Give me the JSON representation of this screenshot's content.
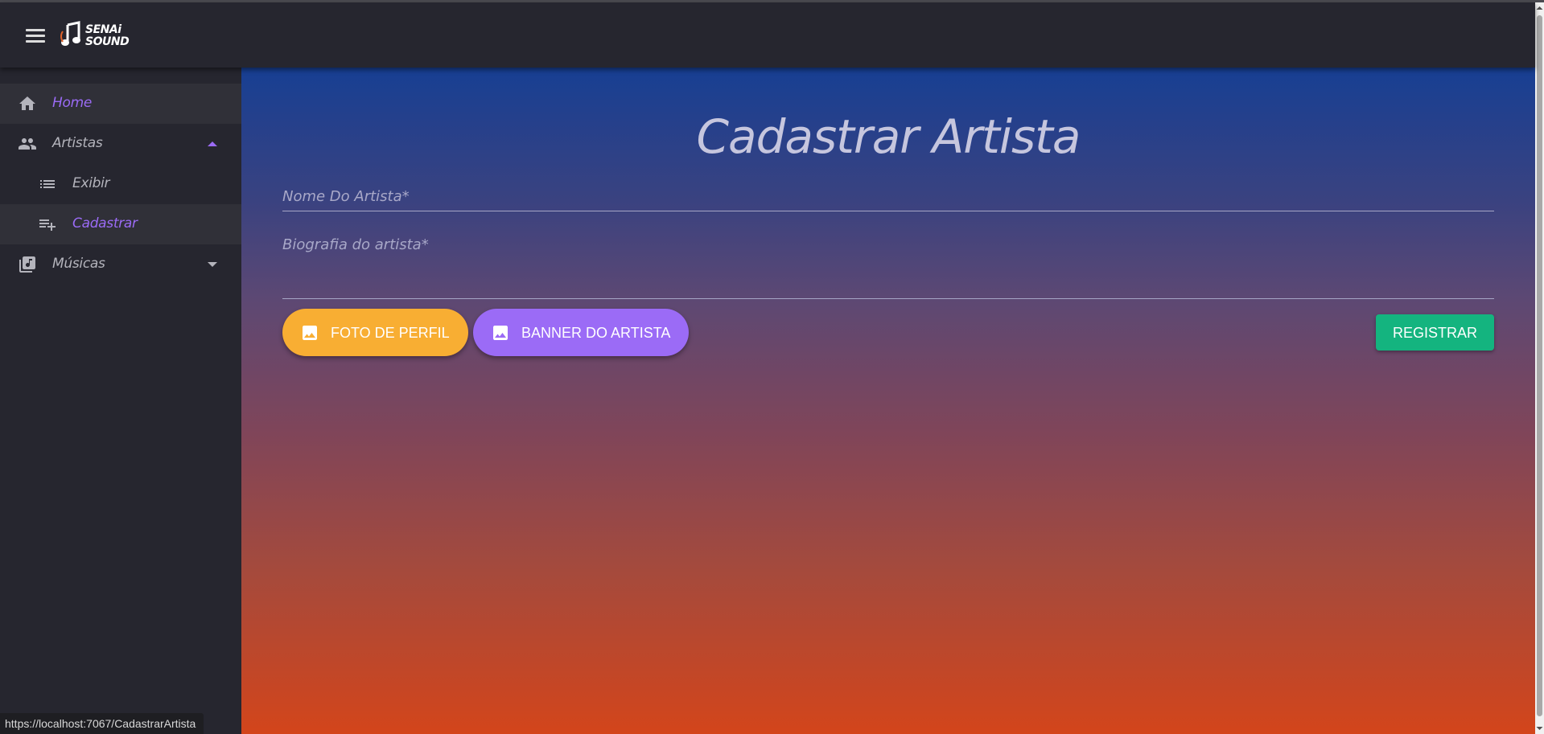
{
  "app": {
    "logo_line1": "SENAi",
    "logo_line2": "SOUND"
  },
  "sidebar": {
    "items": [
      {
        "label": "Home",
        "icon": "home-icon",
        "active": true,
        "color": "#9b6bf6"
      },
      {
        "label": "Artistas",
        "icon": "people-icon",
        "expanded": true
      },
      {
        "label": "Exibir",
        "icon": "list-icon",
        "sub": true
      },
      {
        "label": "Cadastrar",
        "icon": "playlist-add-icon",
        "sub": true,
        "active": true,
        "color": "#9b6bf6"
      },
      {
        "label": "Músicas",
        "icon": "library-music-icon",
        "expanded": false
      }
    ]
  },
  "main": {
    "title": "Cadastrar Artista",
    "name_placeholder": "Nome Do Artista*",
    "bio_placeholder": "Biografia do artista*",
    "photo_button": "FOTO DE PERFIL",
    "banner_button": "BANNER DO ARTISTA",
    "register_button": "REGISTRAR"
  },
  "status_bar": {
    "url": "https://localhost:7067/CadastrarArtista"
  },
  "colors": {
    "photo_button": "#f8ae33",
    "banner_button": "#9b6bf6",
    "register_button": "#14b47f",
    "accent": "#9b6bf6"
  }
}
